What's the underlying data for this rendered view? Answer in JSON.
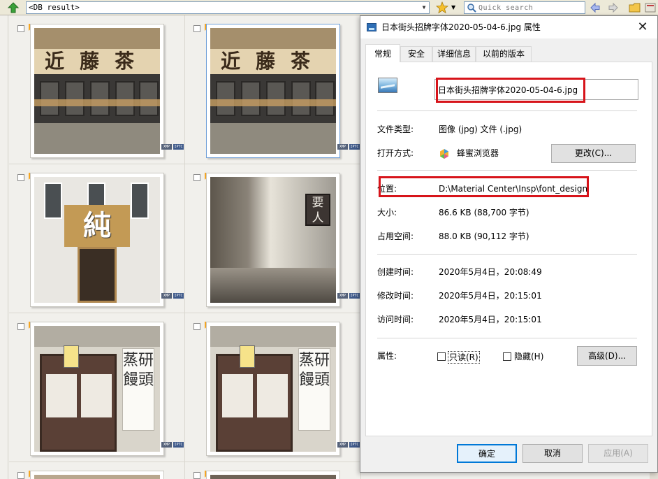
{
  "toolbar": {
    "path_value": "<DB result>",
    "search_placeholder": "Quick search"
  },
  "thumbnails": [
    {
      "id": "t1",
      "sign_text": "近藤茶舗",
      "badge_xmp": "XMP",
      "badge_iptc": "IPTC"
    },
    {
      "id": "t2",
      "sign_text": "近藤茶舗",
      "badge_xmp": "XMP",
      "badge_iptc": "IPTC"
    },
    {
      "id": "t3",
      "sign_text": "純",
      "badge_xmp": "XMP",
      "badge_iptc": "IPTC"
    },
    {
      "id": "t4",
      "sign_text": "要人",
      "badge_xmp": "XMP",
      "badge_iptc": "IPTC"
    },
    {
      "id": "t5",
      "sign_text": "蒸研饅頭",
      "badge_xmp": "XMP",
      "badge_iptc": "IPTC"
    },
    {
      "id": "t6",
      "sign_text": "蒸研饅頭",
      "badge_xmp": "XMP",
      "badge_iptc": "IPTC"
    }
  ],
  "dialog": {
    "title": "日本街头招牌字体2020-05-04-6.jpg 属性",
    "close_glyph": "✕",
    "tabs": [
      "常规",
      "安全",
      "详细信息",
      "以前的版本"
    ],
    "file_name": "日本街头招牌字体2020-05-04-6.jpg",
    "file_type_label": "文件类型:",
    "file_type_value": "图像 (jpg) 文件 (.jpg)",
    "open_with_label": "打开方式:",
    "open_with_value": "蜂蜜浏览器",
    "change_button": "更改(C)...",
    "location_label": "位置:",
    "location_value": "D:\\Material Center\\Insp\\font_design",
    "size_label": "大小:",
    "size_value": "86.6 KB (88,700 字节)",
    "disk_size_label": "占用空间:",
    "disk_size_value": "88.0 KB (90,112 字节)",
    "created_label": "创建时间:",
    "created_value": "2020年5月4日，20:08:49",
    "modified_label": "修改时间:",
    "modified_value": "2020年5月4日，20:15:01",
    "accessed_label": "访问时间:",
    "accessed_value": "2020年5月4日，20:15:01",
    "attributes_label": "属性:",
    "readonly_label": "只读(R)",
    "hidden_label": "隐藏(H)",
    "advanced_button": "高级(D)...",
    "ok_button": "确定",
    "cancel_button": "取消",
    "apply_button": "应用(A)"
  },
  "colors": {
    "highlight_red": "#d7141a",
    "focus_blue": "#0078d7"
  }
}
